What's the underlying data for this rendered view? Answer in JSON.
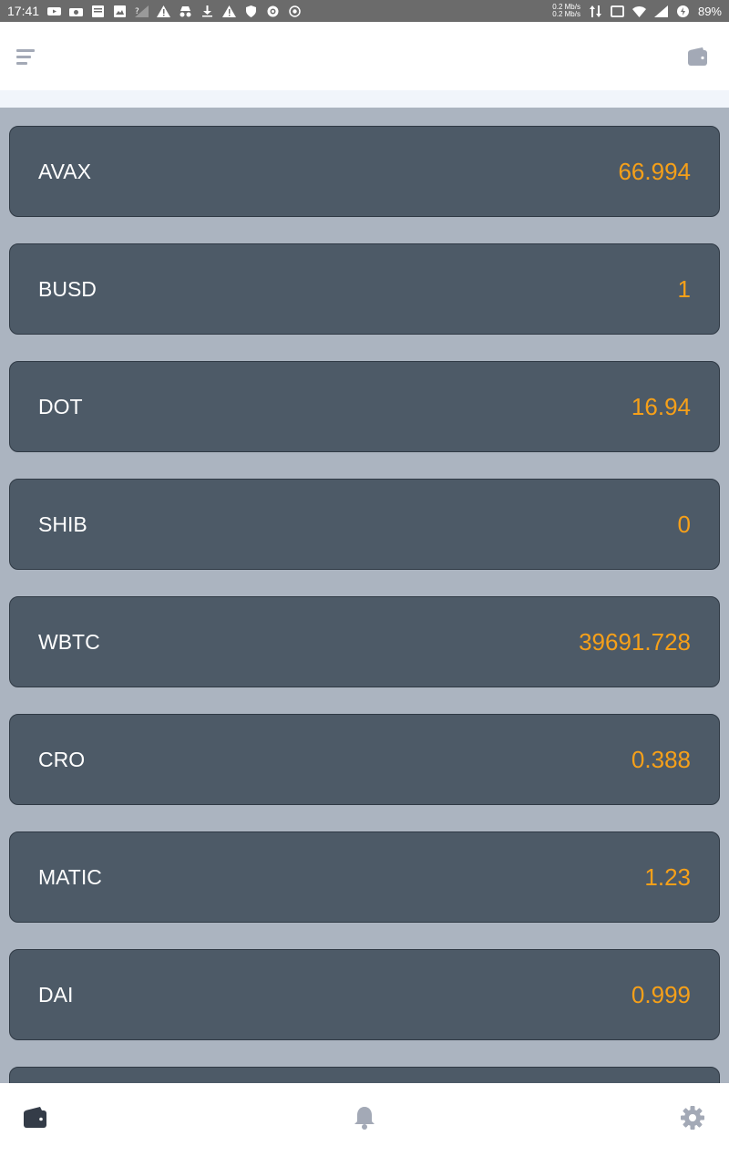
{
  "status_bar": {
    "time": "17:41",
    "net_up": "0.2 Mb/s",
    "net_down": "0.2 Mb/s",
    "battery": "89%"
  },
  "header": {
    "menu_icon": "menu-icon",
    "wallet_icon": "wallet-icon"
  },
  "coins": [
    {
      "symbol": "AVAX",
      "price": "66.994"
    },
    {
      "symbol": "BUSD",
      "price": "1"
    },
    {
      "symbol": "DOT",
      "price": "16.94"
    },
    {
      "symbol": "SHIB",
      "price": "0"
    },
    {
      "symbol": "WBTC",
      "price": "39691.728"
    },
    {
      "symbol": "CRO",
      "price": "0.388"
    },
    {
      "symbol": "MATIC",
      "price": "1.23"
    },
    {
      "symbol": "DAI",
      "price": "0.999"
    }
  ],
  "bottom_nav": {
    "items": [
      "wallet-icon",
      "bell-icon",
      "gear-icon"
    ]
  },
  "colors": {
    "card_bg": "#4d5a67",
    "list_bg": "#abb4c0",
    "price": "#f6a019",
    "status_bar": "#6b6b6b"
  }
}
